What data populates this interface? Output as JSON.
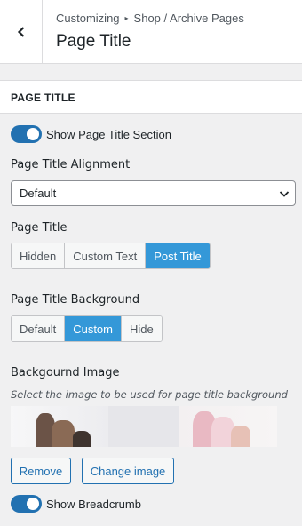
{
  "header": {
    "breadcrumb_root": "Customizing",
    "breadcrumb_section": "Shop / Archive Pages",
    "title": "Page Title"
  },
  "section": {
    "heading": "PAGE TITLE"
  },
  "controls": {
    "show_section_label": "Show Page Title Section",
    "show_section_on": true,
    "alignment_label": "Page Title Alignment",
    "alignment_value": "Default",
    "page_title_label": "Page Title",
    "page_title_options": [
      "Hidden",
      "Custom Text",
      "Post Title"
    ],
    "page_title_selected": "Post Title",
    "background_label": "Page Title Background",
    "background_options": [
      "Default",
      "Custom",
      "Hide"
    ],
    "background_selected": "Custom",
    "bg_image_label": "Backgournd Image",
    "bg_image_desc": "Select the image to be used for page title background",
    "remove_label": "Remove",
    "change_image_label": "Change image",
    "show_breadcrumb_label": "Show Breadcrumb",
    "show_breadcrumb_on": true
  },
  "icons": {
    "back": "chevron-left-icon",
    "breadcrumb_separator": "triangle-right-icon",
    "dropdown": "chevron-down-icon"
  },
  "colors": {
    "accent": "#2271b1",
    "active_segment": "#3498d8",
    "panel_bg": "#f0f0f1"
  }
}
